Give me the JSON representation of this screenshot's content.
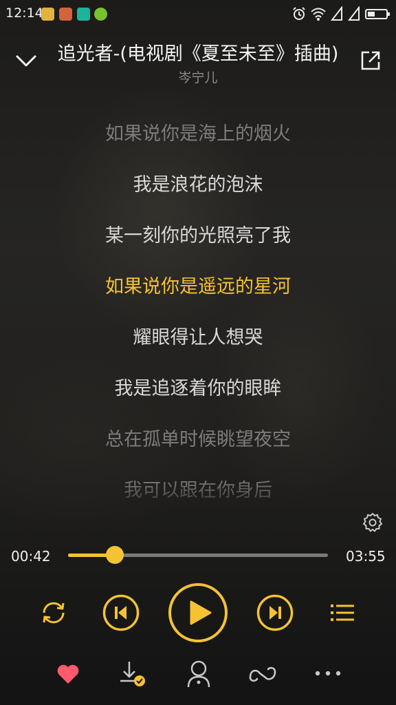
{
  "status_bar": {
    "time": "12:14"
  },
  "header": {
    "title": "追光者-(电视剧《夏至未至》插曲)",
    "artist": "岑宁儿"
  },
  "lyrics": [
    {
      "text": "如果说你是海上的烟火",
      "state": "dim"
    },
    {
      "text": "我是浪花的泡沫",
      "state": "normal"
    },
    {
      "text": "某一刻你的光照亮了我",
      "state": "normal"
    },
    {
      "text": "如果说你是遥远的星河",
      "state": "active"
    },
    {
      "text": "耀眼得让人想哭",
      "state": "normal"
    },
    {
      "text": "我是追逐着你的眼眸",
      "state": "normal"
    },
    {
      "text": "总在孤单时候眺望夜空",
      "state": "dim"
    },
    {
      "text": "我可以跟在你身后",
      "state": "fade"
    }
  ],
  "player": {
    "elapsed": "00:42",
    "total": "03:55",
    "progress": 0.18
  },
  "colors": {
    "accent": "#f5c332",
    "favorite": "#ff5a6e",
    "lyric_active": "#f5c332"
  },
  "icons": {
    "collapse": "chevron-down-icon",
    "share": "share-icon",
    "settings": "gear-icon",
    "repeat": "repeat-icon",
    "previous": "skip-previous-icon",
    "play": "play-icon",
    "next": "skip-next-icon",
    "playlist": "playlist-icon",
    "favorite": "heart-icon",
    "download": "download-icon",
    "singer": "singer-icon",
    "loop": "loop-icon",
    "more": "more-icon"
  }
}
